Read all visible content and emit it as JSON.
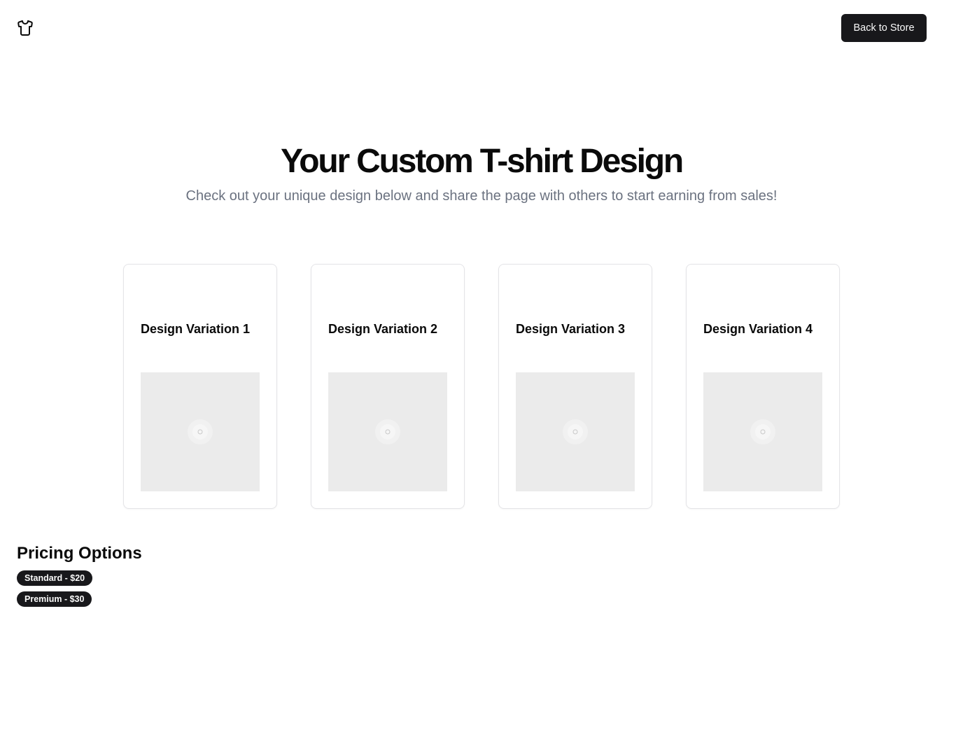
{
  "header": {
    "logo_icon": "tshirt-icon",
    "back_button_label": "Back to Store"
  },
  "hero": {
    "title": "Your Custom T-shirt Design",
    "subtitle": "Check out your unique design below and share the page with others to start earning from sales!"
  },
  "designs": [
    {
      "title": "Design Variation 1",
      "image_icon": "loading-spinner-icon"
    },
    {
      "title": "Design Variation 2",
      "image_icon": "loading-spinner-icon"
    },
    {
      "title": "Design Variation 3",
      "image_icon": "loading-spinner-icon"
    },
    {
      "title": "Design Variation 4",
      "image_icon": "loading-spinner-icon"
    }
  ],
  "pricing": {
    "title": "Pricing Options",
    "options": [
      {
        "label": "Standard - $20"
      },
      {
        "label": "Premium - $30"
      }
    ]
  },
  "colors": {
    "primary": "#18181b",
    "muted_text": "#6b7280",
    "placeholder_bg": "#ebebeb",
    "border": "#e4e4e7"
  }
}
